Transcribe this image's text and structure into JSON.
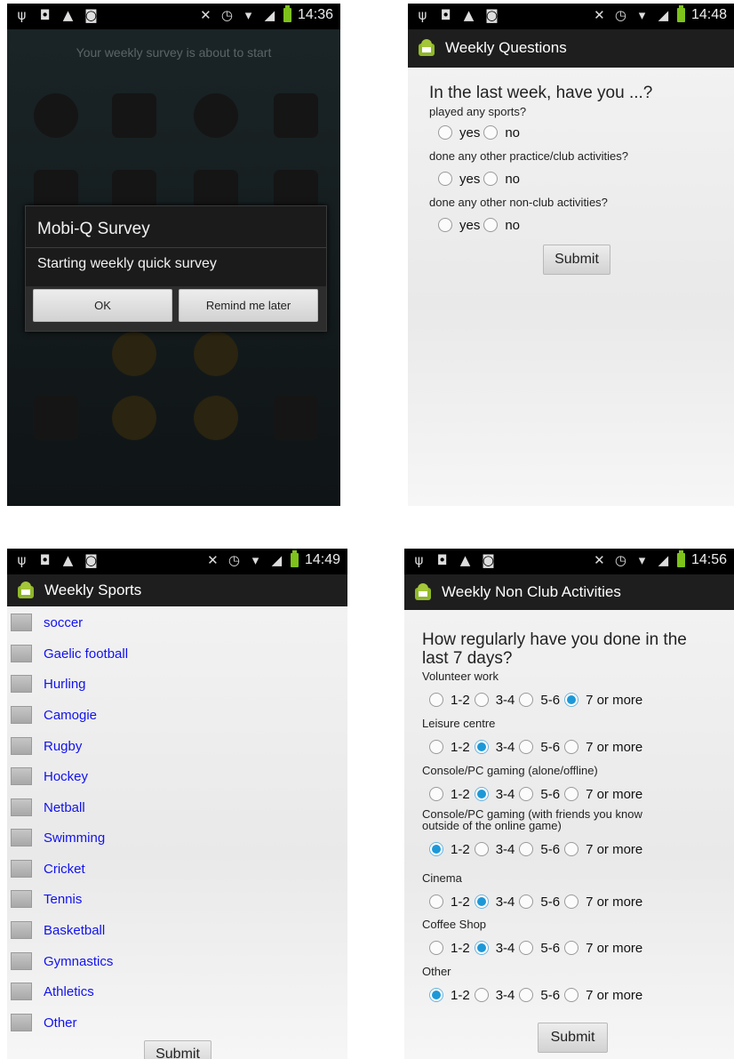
{
  "screen1": {
    "time": "14:36",
    "banner": "Your weekly survey is about to start",
    "dialog": {
      "title": "Mobi-Q Survey",
      "message": "Starting weekly quick survey",
      "ok_label": "OK",
      "remind_label": "Remind me later"
    }
  },
  "screen2": {
    "time": "14:48",
    "app_title": "Weekly Questions",
    "heading": "In the last week, have you ...?",
    "questions": [
      {
        "label": "played any sports?",
        "options": [
          "yes",
          "no"
        ]
      },
      {
        "label": "done any other practice/club activities?",
        "options": [
          "yes",
          "no"
        ]
      },
      {
        "label": "done any other non-club activities?",
        "options": [
          "yes",
          "no"
        ]
      }
    ],
    "submit_label": "Submit"
  },
  "screen3": {
    "time": "14:49",
    "app_title": "Weekly Sports",
    "sports": [
      "soccer",
      "Gaelic football",
      "Hurling",
      "Camogie",
      "Rugby",
      "Hockey",
      "Netball",
      "Swimming",
      "Cricket",
      "Tennis",
      "Basketball",
      "Gymnastics",
      "Athletics",
      "Other"
    ],
    "submit_label": "Submit"
  },
  "screen4": {
    "time": "14:56",
    "app_title": "Weekly Non Club Activities",
    "heading_line1": "How regularly have you done in the",
    "heading_line2": "last 7 days?",
    "options": [
      "1-2",
      "3-4",
      "5-6",
      "7 or more"
    ],
    "activities": [
      {
        "label": "Volunteer work",
        "selected": "7 or more"
      },
      {
        "label": "Leisure centre",
        "selected": "3-4"
      },
      {
        "label": "Console/PC gaming (alone/offline)",
        "selected": "3-4"
      },
      {
        "label": "Console/PC gaming (with friends you know",
        "label2": "outside of the online game)",
        "selected": "1-2"
      },
      {
        "label": "Cinema",
        "selected": "3-4"
      },
      {
        "label": "Coffee Shop",
        "selected": "3-4"
      },
      {
        "label": "Other",
        "selected": "1-2"
      }
    ],
    "submit_label": "Submit"
  },
  "colors": {
    "accent_radio": "#1d98d7",
    "link_blue": "#1212ee",
    "status_battery": "#7ec21c"
  }
}
